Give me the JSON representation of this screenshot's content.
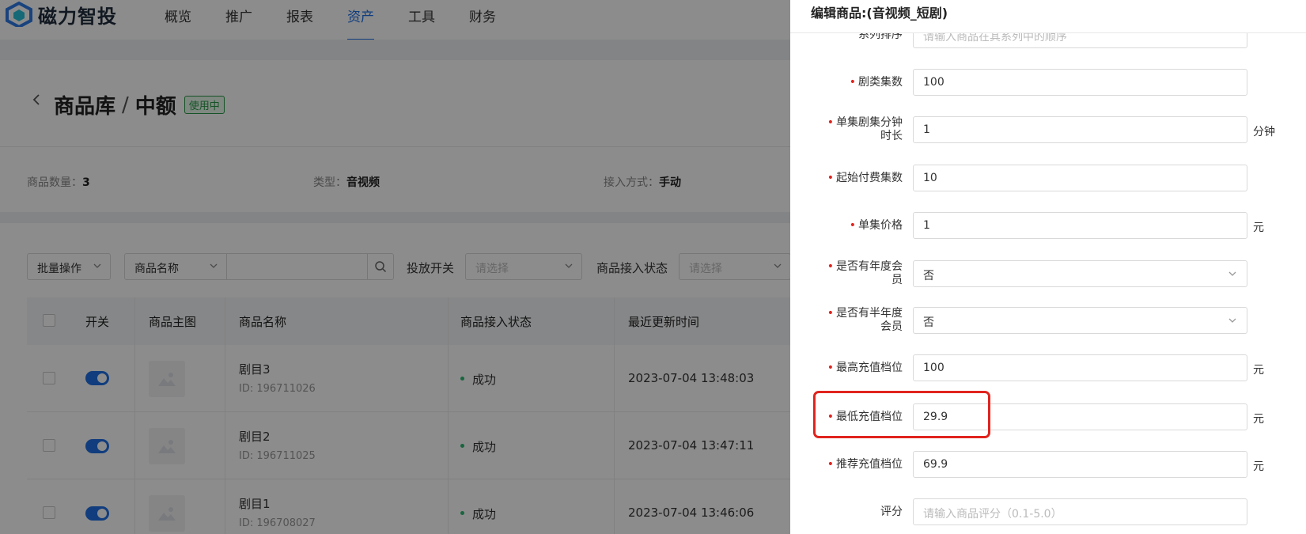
{
  "app": {
    "brand": "磁力智投"
  },
  "nav": {
    "items": [
      "概览",
      "推广",
      "报表",
      "资产",
      "工具",
      "财务"
    ],
    "active_index": 3
  },
  "page": {
    "breadcrumb_parent": "商品库",
    "breadcrumb_sep": "/",
    "breadcrumb_current": "中额",
    "status_tag": "使用中"
  },
  "info": {
    "count_label": "商品数量：",
    "count_value": "3",
    "type_label": "类型：",
    "type_value": "音视频",
    "access_label": "接入方式：",
    "access_value": "手动"
  },
  "filters": {
    "batch": "批量操作",
    "name_select": "商品名称",
    "search_value": "",
    "launch_label": "投放开关",
    "launch_placeholder": "请选择",
    "access_status_label": "商品接入状态",
    "access_status_placeholder": "请选择"
  },
  "table": {
    "headers": [
      "开关",
      "商品主图",
      "商品名称",
      "商品接入状态",
      "最近更新时间"
    ],
    "rows": [
      {
        "name": "剧目3",
        "id": "ID: 196711026",
        "status": "成功",
        "time": "2023-07-04 13:48:03",
        "enabled": true
      },
      {
        "name": "剧目2",
        "id": "ID: 196711025",
        "status": "成功",
        "time": "2023-07-04 13:47:11",
        "enabled": true
      },
      {
        "name": "剧目1",
        "id": "ID: 196708027",
        "status": "成功",
        "time": "2023-07-04 13:46:06",
        "enabled": true
      }
    ]
  },
  "drawer": {
    "title": "编辑商品:(音视频_短剧)",
    "fields": [
      {
        "label": "系列排序",
        "value": "",
        "placeholder": "请输入商品在其系列中的顺序",
        "required": false,
        "unit": "",
        "type": "input"
      },
      {
        "label": "剧类集数",
        "value": "100",
        "placeholder": "",
        "required": true,
        "unit": "",
        "type": "input"
      },
      {
        "label": "单集剧集分钟时长",
        "value": "1",
        "placeholder": "",
        "required": true,
        "unit": "分钟",
        "type": "input"
      },
      {
        "label": "起始付费集数",
        "value": "10",
        "placeholder": "",
        "required": true,
        "unit": "",
        "type": "input"
      },
      {
        "label": "单集价格",
        "value": "1",
        "placeholder": "",
        "required": true,
        "unit": "元",
        "type": "input"
      },
      {
        "label": "是否有年度会员",
        "value": "否",
        "placeholder": "",
        "required": true,
        "unit": "",
        "type": "select"
      },
      {
        "label": "是否有半年度会员",
        "value": "否",
        "placeholder": "",
        "required": true,
        "unit": "",
        "type": "select"
      },
      {
        "label": "最高充值档位",
        "value": "100",
        "placeholder": "",
        "required": true,
        "unit": "元",
        "type": "input"
      },
      {
        "label": "最低充值档位",
        "value": "29.9",
        "placeholder": "",
        "required": true,
        "unit": "元",
        "type": "input"
      },
      {
        "label": "推荐充值档位",
        "value": "69.9",
        "placeholder": "",
        "required": true,
        "unit": "元",
        "type": "input"
      },
      {
        "label": "评分",
        "value": "",
        "placeholder": "请输入商品评分（0.1-5.0）",
        "required": false,
        "unit": "",
        "type": "input"
      }
    ]
  },
  "colors": {
    "accent": "#1f6fe5",
    "success": "#2eb872",
    "required": "#e0241e",
    "highlight": "#e0241e"
  }
}
